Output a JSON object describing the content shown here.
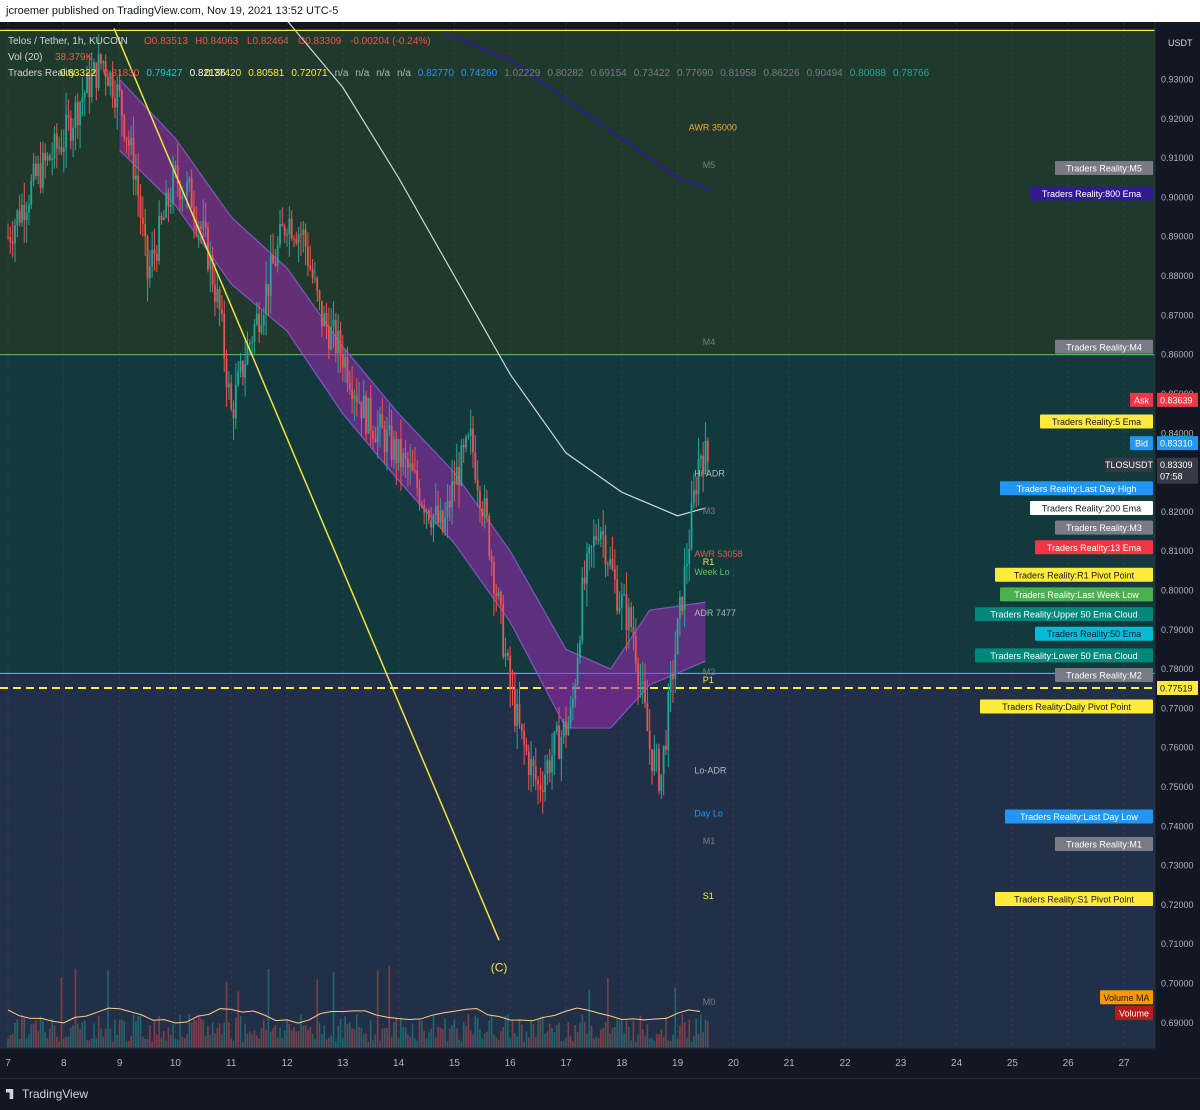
{
  "header": {
    "published_text": "jcroemer published on TradingView.com, Nov 19, 2021 13:52 UTC-5"
  },
  "footer": {
    "logo_text": "TradingView"
  },
  "legend": {
    "symbol_line": "Telos / Tether, 1h, KUCOIN",
    "ohlc": [
      "O0.83513",
      "H0.84063",
      "L0.82464",
      "C0.83309",
      "-0.00204 (-0.24%)"
    ],
    "vol_label": "Vol (20)",
    "vol_value": "38.379K",
    "indicator_label": "Traders Reality",
    "indicator_values": [
      "0.83322",
      "0.81830",
      "0.79427",
      "0.82136",
      "0.77420",
      "0.80581",
      "0.72071",
      "n/a",
      "n/a",
      "n/a",
      "n/a",
      "0.82770",
      "0.74260",
      "1.02229",
      "0.80282",
      "0.69154",
      "0.73422",
      "0.77690",
      "0.81958",
      "0.86226",
      "0.90494",
      "0.80088",
      "0.78766"
    ]
  },
  "chart_data": {
    "type": "candlestick",
    "symbol": "TLOSUSDT",
    "quote_unit": "USDT",
    "x_axis": {
      "tick_labels": [
        "7",
        "8",
        "9",
        "10",
        "11",
        "12",
        "13",
        "14",
        "15",
        "16",
        "17",
        "18",
        "19",
        "20",
        "21",
        "22",
        "23",
        "24",
        "25",
        "26",
        "27"
      ]
    },
    "y_axis": {
      "range": [
        0.6836,
        0.9426
      ],
      "tick_labels": [
        "0.90000",
        "0.89000",
        "0.88000",
        "0.87000",
        "0.86000",
        "0.85000",
        "0.84000",
        "0.83000",
        "0.82000",
        "0.81000",
        "0.80000",
        "0.79000",
        "0.78000",
        "0.77000",
        "0.76000",
        "0.75000",
        "0.74000",
        "0.73000",
        "0.72000",
        "0.71000",
        "0.70000",
        "0.69000",
        "0.91000",
        "0.92000",
        "0.93000"
      ]
    },
    "price_path": [
      [
        7.0,
        0.89
      ],
      [
        7.5,
        0.905
      ],
      [
        8.0,
        0.915
      ],
      [
        8.3,
        0.925
      ],
      [
        8.7,
        0.935
      ],
      [
        9.0,
        0.925
      ],
      [
        9.3,
        0.905
      ],
      [
        9.5,
        0.88
      ],
      [
        9.8,
        0.895
      ],
      [
        10.0,
        0.905
      ],
      [
        10.3,
        0.9
      ],
      [
        10.6,
        0.885
      ],
      [
        10.8,
        0.87
      ],
      [
        11.0,
        0.845
      ],
      [
        11.3,
        0.862
      ],
      [
        11.6,
        0.875
      ],
      [
        12.0,
        0.895
      ],
      [
        12.3,
        0.89
      ],
      [
        12.6,
        0.87
      ],
      [
        13.0,
        0.86
      ],
      [
        13.4,
        0.845
      ],
      [
        13.8,
        0.838
      ],
      [
        14.2,
        0.83
      ],
      [
        14.5,
        0.822
      ],
      [
        14.8,
        0.815
      ],
      [
        15.0,
        0.828
      ],
      [
        15.3,
        0.838
      ],
      [
        15.6,
        0.815
      ],
      [
        15.8,
        0.795
      ],
      [
        16.0,
        0.775
      ],
      [
        16.2,
        0.762
      ],
      [
        16.5,
        0.75
      ],
      [
        16.8,
        0.76
      ],
      [
        17.1,
        0.768
      ],
      [
        17.3,
        0.8
      ],
      [
        17.6,
        0.818
      ],
      [
        17.9,
        0.8
      ],
      [
        18.2,
        0.79
      ],
      [
        18.5,
        0.76
      ],
      [
        18.7,
        0.752
      ],
      [
        18.9,
        0.778
      ],
      [
        19.2,
        0.812
      ],
      [
        19.4,
        0.836
      ],
      [
        19.55,
        0.833
      ]
    ],
    "bands": [
      {
        "name": "Upper 50 Ema Cloud",
        "points": [
          [
            9.0,
            0.93
          ],
          [
            10.0,
            0.915
          ],
          [
            11.0,
            0.895
          ],
          [
            12.0,
            0.882
          ],
          [
            13.0,
            0.862
          ],
          [
            14.0,
            0.845
          ],
          [
            15.0,
            0.83
          ],
          [
            16.0,
            0.81
          ],
          [
            17.0,
            0.785
          ],
          [
            17.8,
            0.78
          ],
          [
            18.5,
            0.795
          ],
          [
            19.5,
            0.797
          ]
        ]
      },
      {
        "name": "Lower 50 Ema Cloud",
        "points": [
          [
            9.0,
            0.912
          ],
          [
            10.0,
            0.898
          ],
          [
            11.0,
            0.878
          ],
          [
            12.0,
            0.866
          ],
          [
            13.0,
            0.845
          ],
          [
            14.0,
            0.828
          ],
          [
            15.0,
            0.812
          ],
          [
            16.0,
            0.792
          ],
          [
            17.0,
            0.765
          ],
          [
            17.8,
            0.765
          ],
          [
            18.5,
            0.776
          ],
          [
            19.5,
            0.782
          ]
        ]
      }
    ],
    "lines": [
      {
        "name": "200 Ema",
        "color": "#d1d4dc",
        "points": [
          [
            12.0,
            0.945
          ],
          [
            13.0,
            0.928
          ],
          [
            14.0,
            0.905
          ],
          [
            15.0,
            0.88
          ],
          [
            16.0,
            0.855
          ],
          [
            17.0,
            0.835
          ],
          [
            18.0,
            0.825
          ],
          [
            19.0,
            0.819
          ],
          [
            19.5,
            0.821
          ]
        ]
      },
      {
        "name": "800 Ema",
        "color": "#311b92",
        "points": [
          [
            14.8,
            0.942
          ],
          [
            16.0,
            0.935
          ],
          [
            17.0,
            0.925
          ],
          [
            18.0,
            0.915
          ],
          [
            19.0,
            0.905
          ],
          [
            19.6,
            0.902
          ]
        ]
      }
    ],
    "trendline": {
      "color": "#f0e442",
      "points": [
        [
          8.9,
          0.943
        ],
        [
          15.8,
          0.711
        ]
      ]
    },
    "wave_label": {
      "text": "(C)",
      "x": 15.8,
      "y": 0.703
    },
    "horizontal_levels": [
      {
        "price": 0.86,
        "color": "#4caf50"
      },
      {
        "price": 0.7789,
        "color": "#26c6da"
      },
      {
        "price": 0.77519,
        "color": "#ffeb3b",
        "dashed": true
      },
      {
        "price": 0.9425,
        "color": "#ffeb3b"
      }
    ],
    "chart_labels": [
      {
        "text": "AWR 35000",
        "x": 19.2,
        "y": 0.917,
        "color": "#f9a825"
      },
      {
        "text": "M5",
        "x": 19.45,
        "y": 0.9075,
        "color": "#787b86"
      },
      {
        "text": "M4",
        "x": 19.45,
        "y": 0.8625,
        "color": "#787b86"
      },
      {
        "text": "Hi-ADR",
        "x": 19.3,
        "y": 0.829,
        "color": "#b2b5be"
      },
      {
        "text": "M3",
        "x": 19.45,
        "y": 0.8195,
        "color": "#787b86"
      },
      {
        "text": "AWR 53058",
        "x": 19.3,
        "y": 0.8085,
        "color": "#ef5350"
      },
      {
        "text": "R1",
        "x": 19.45,
        "y": 0.8065,
        "color": "#ffeb3b"
      },
      {
        "text": "Week Lo",
        "x": 19.3,
        "y": 0.804,
        "color": "#66bb6a"
      },
      {
        "text": "ADR 7477",
        "x": 19.3,
        "y": 0.7935,
        "color": "#b2b5be"
      },
      {
        "text": "M2",
        "x": 19.45,
        "y": 0.7785,
        "color": "#787b86"
      },
      {
        "text": "P1",
        "x": 19.45,
        "y": 0.7765,
        "color": "#ffeb3b"
      },
      {
        "text": "Lo-ADR",
        "x": 19.3,
        "y": 0.7535,
        "color": "#b2b5be"
      },
      {
        "text": "Day Lo",
        "x": 19.3,
        "y": 0.7425,
        "color": "#2196f3"
      },
      {
        "text": "M1",
        "x": 19.45,
        "y": 0.7355,
        "color": "#787b86"
      },
      {
        "text": "S1",
        "x": 19.45,
        "y": 0.7215,
        "color": "#ffeb3b"
      },
      {
        "text": "M0",
        "x": 19.45,
        "y": 0.6945,
        "color": "#787b86"
      }
    ],
    "right_labels": [
      {
        "text": "Traders Reality:M5",
        "y": 0.9075,
        "bg": "#787b86",
        "fg": "#ffffff"
      },
      {
        "text": "Traders Reality:800 Ema",
        "y": 0.901,
        "bg": "#311b92",
        "fg": "#ffffff"
      },
      {
        "text": "Traders Reality:M4",
        "y": 0.862,
        "bg": "#787b86",
        "fg": "#ffffff"
      },
      {
        "text": "Ask",
        "y": 0.8485,
        "bg": "#f23645",
        "fg": "#ffffff"
      },
      {
        "text": "Traders Reality:5 Ema",
        "y": 0.843,
        "bg": "#ffeb3b",
        "fg": "#131722"
      },
      {
        "text": "Bid",
        "y": 0.8375,
        "bg": "#2196f3",
        "fg": "#ffffff"
      },
      {
        "text": "TLOSUSDT",
        "y": 0.832,
        "bg": "#363a45",
        "fg": "#ffffff"
      },
      {
        "text": "Traders Reality:Last Day High",
        "y": 0.826,
        "bg": "#2196f3",
        "fg": "#ffffff"
      },
      {
        "text": "Traders Reality:200 Ema",
        "y": 0.821,
        "bg": "#ffffff",
        "fg": "#131722"
      },
      {
        "text": "Traders Reality:M3",
        "y": 0.816,
        "bg": "#787b86",
        "fg": "#ffffff"
      },
      {
        "text": "Traders Reality:13 Ema",
        "y": 0.811,
        "bg": "#f23645",
        "fg": "#ffffff"
      },
      {
        "text": "Traders Reality:R1 Pivot Point",
        "y": 0.804,
        "bg": "#ffeb3b",
        "fg": "#131722"
      },
      {
        "text": "Traders Reality:Last Week Low",
        "y": 0.799,
        "bg": "#4caf50",
        "fg": "#ffffff"
      },
      {
        "text": "Traders Reality:Upper 50 Ema Cloud",
        "y": 0.794,
        "bg": "#00897b",
        "fg": "#ffffff"
      },
      {
        "text": "Traders Reality:50 Ema",
        "y": 0.789,
        "bg": "#00bcd4",
        "fg": "#131722"
      },
      {
        "text": "Traders Reality:Lower 50 Ema Cloud",
        "y": 0.7835,
        "bg": "#00897b",
        "fg": "#ffffff"
      },
      {
        "text": "Traders Reality:M2",
        "y": 0.7785,
        "bg": "#787b86",
        "fg": "#ffffff"
      },
      {
        "text": "Traders Reality:Daily Pivot Point",
        "y": 0.7705,
        "bg": "#ffeb3b",
        "fg": "#131722"
      },
      {
        "text": "Traders Reality:Last Day Low",
        "y": 0.7425,
        "bg": "#2196f3",
        "fg": "#ffffff"
      },
      {
        "text": "Traders Reality:M1",
        "y": 0.7355,
        "bg": "#787b86",
        "fg": "#ffffff"
      },
      {
        "text": "Traders Reality:S1 Pivot Point",
        "y": 0.7215,
        "bg": "#ffeb3b",
        "fg": "#131722"
      },
      {
        "text": "Volume MA",
        "y": 0.6965,
        "bg": "#ff9800",
        "fg": "#131722"
      },
      {
        "text": "Volume",
        "y": 0.6925,
        "bg": "#b71c1c",
        "fg": "#ffffff"
      }
    ],
    "axis_price_labels": [
      {
        "text": "0.83639",
        "y": 0.8485,
        "bg": "#f23645",
        "fg": "#ffffff"
      },
      {
        "text": "0.83310",
        "y": 0.8375,
        "bg": "#2196f3",
        "fg": "#ffffff"
      },
      {
        "text": "0.83309",
        "sub": "07:58",
        "y": 0.832,
        "bg": "#363a45",
        "fg": "#ffffff"
      },
      {
        "text": "0.77519",
        "y": 0.7752,
        "bg": "#ffeb3b",
        "fg": "#131722"
      }
    ],
    "colors": {
      "up": "#26a69a",
      "down": "#ef5350",
      "zone_top": "#1f3a2c",
      "zone_mid": "#123a3d",
      "zone_low": "#223047",
      "cloud": "#9c27b0",
      "bg": "#131722"
    }
  }
}
